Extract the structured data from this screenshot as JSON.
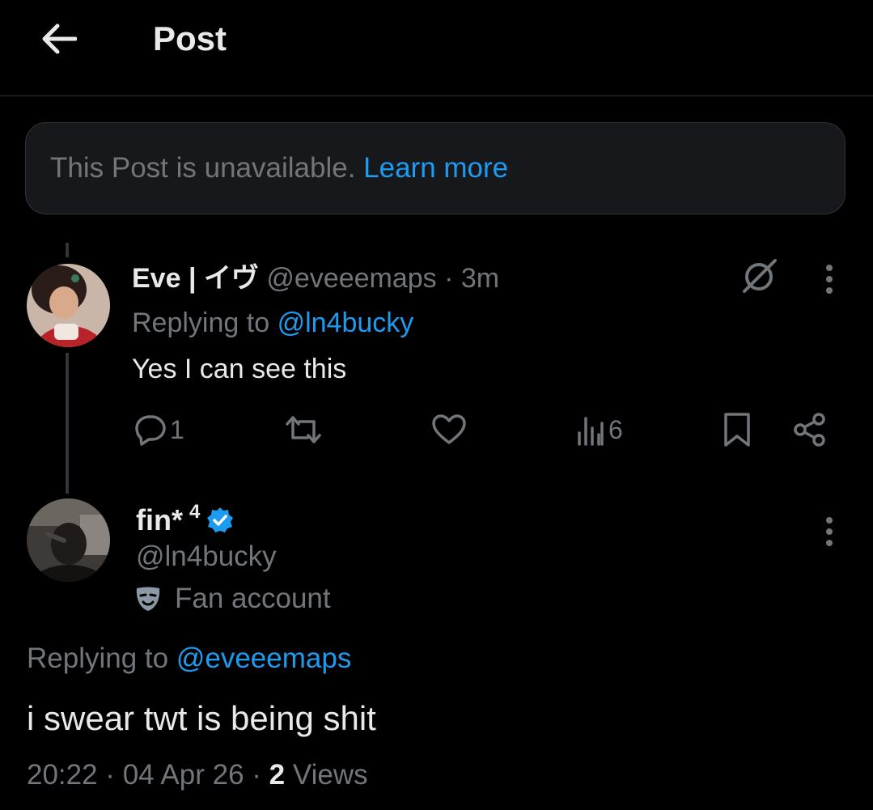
{
  "header": {
    "title": "Post"
  },
  "notice": {
    "text": "This Post is unavailable.",
    "link": "Learn more"
  },
  "reply_post": {
    "display_name": "Eve | イヴ",
    "handle": "@eveeemaps",
    "time": "· 3m",
    "replying_prefix": "Replying to",
    "replying_to": "@ln4bucky",
    "body": "Yes I can see this",
    "replies": "1",
    "reposts": "",
    "likes": "",
    "views": "6"
  },
  "main_post": {
    "display_name": "fin*",
    "name_suffix": "4",
    "handle": "@ln4bucky",
    "label": "Fan account",
    "replying_prefix": "Replying to",
    "replying_to": "@eveeemaps",
    "body": "i swear twt is being shit",
    "meta_time": "20:22 · 04 Apr 26 ·",
    "views_count": "2",
    "views_label": "Views"
  },
  "colors": {
    "accent": "#1d9bf0",
    "muted": "#71767b",
    "text": "#e7e9ea",
    "bg": "#000000"
  }
}
